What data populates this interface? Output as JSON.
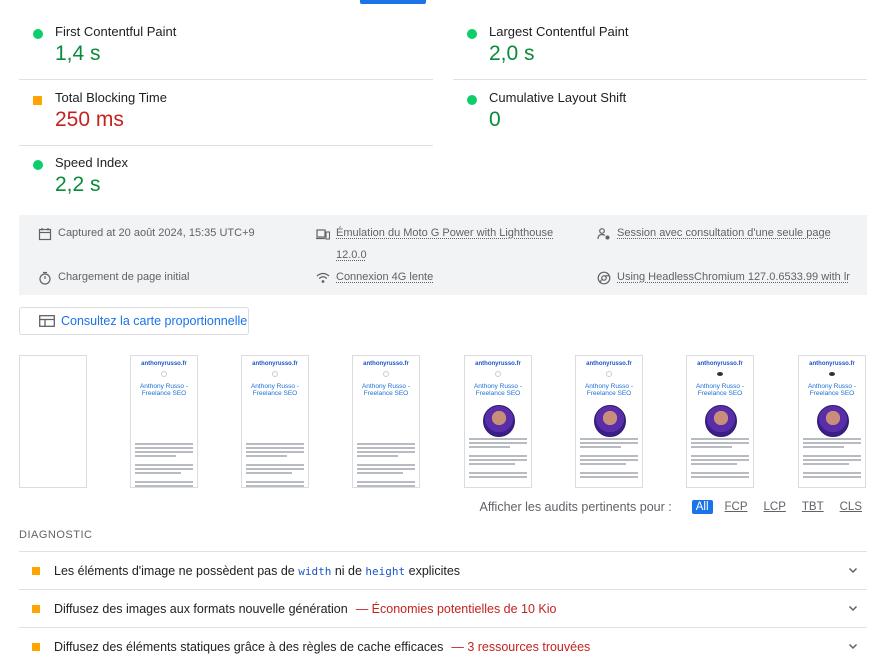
{
  "metrics": [
    {
      "name": "First Contentful Paint",
      "value": "1,4 s",
      "status": "pass"
    },
    {
      "name": "Largest Contentful Paint",
      "value": "2,0 s",
      "status": "pass"
    },
    {
      "name": "Total Blocking Time",
      "value": "250 ms",
      "status": "average"
    },
    {
      "name": "Cumulative Layout Shift",
      "value": "0",
      "status": "pass"
    },
    {
      "name": "Speed Index",
      "value": "2,2 s",
      "status": "pass"
    }
  ],
  "colors": {
    "pass": "#0cce6b",
    "pass_text": "#0a8a3a",
    "average": "#ffa400",
    "fail_text": "#c5221f",
    "accent": "#1a73e8"
  },
  "runtime": {
    "captured": "Captured at 20 août 2024, 15:35 UTC+9",
    "emulation": "Émulation du Moto G Power with Lighthouse",
    "version": "12.0.0",
    "session": "Session avec consultation d'une seule page",
    "load": "Chargement de page initial",
    "network": "Connexion 4G lente",
    "browser": "Using HeadlessChromium 127.0.6533.99 with lr"
  },
  "treemap": {
    "label": "Consultez la carte proportionnelle",
    "icon": "treemap-icon"
  },
  "filmstrip": {
    "site": "anthonyrusso.fr",
    "heading_line1": "Anthony Russo -",
    "heading_line2": "Freelance SEO"
  },
  "filters": {
    "label": "Afficher les audits pertinents pour :",
    "options": [
      "All",
      "FCP",
      "LCP",
      "TBT",
      "CLS"
    ],
    "selected": "All"
  },
  "diagnostics": {
    "title": "DIAGNOSTIC",
    "items": [
      {
        "pre": "Les éléments d'image ne possèdent pas de ",
        "code1": "width",
        "mid": " ni de ",
        "code2": "height",
        "post": " explicites"
      },
      {
        "text": "Diffusez des images aux formats nouvelle génération",
        "savings": "— Économies potentielles de 10 Kio"
      },
      {
        "text": "Diffusez des éléments statiques grâce à des règles de cache efficaces",
        "savings": "— 3 ressources trouvées"
      }
    ]
  }
}
